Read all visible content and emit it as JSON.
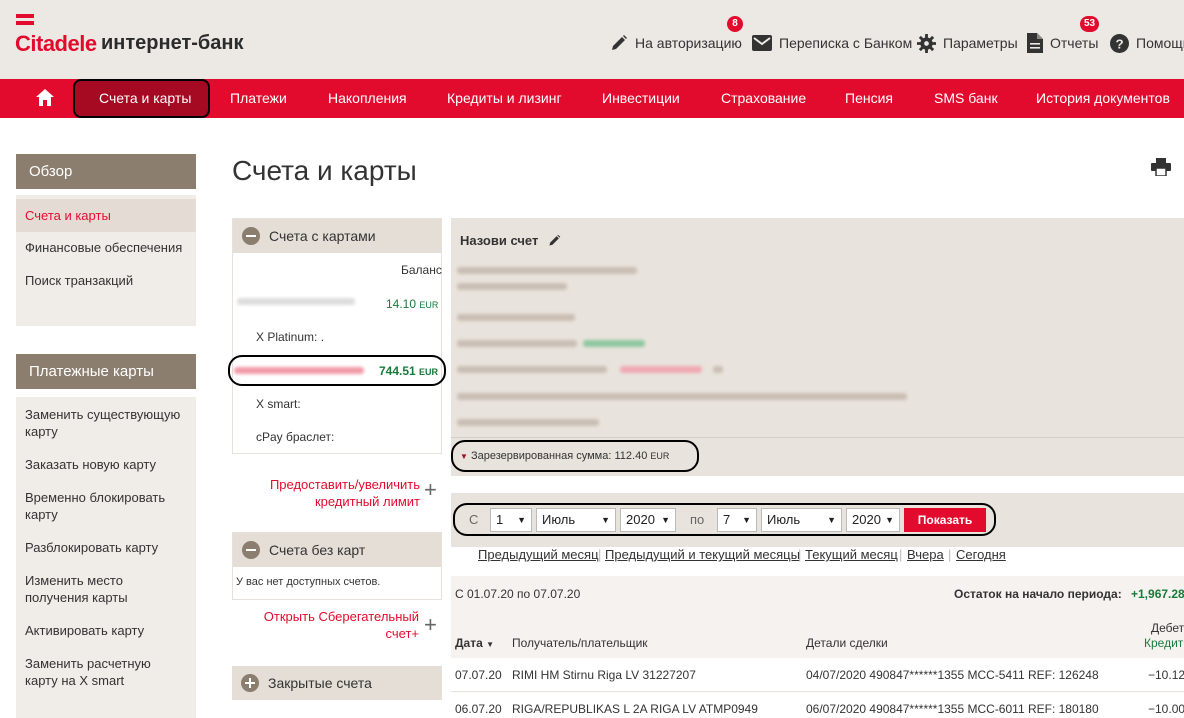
{
  "brand": {
    "name": "Citadele",
    "subtitle": "интернет-банк",
    "accent": "#e30b2d"
  },
  "header": {
    "authorize": {
      "label": "На авторизацию",
      "badge": "8",
      "icon": "pencil-icon"
    },
    "messages": {
      "label": "Переписка с Банком",
      "icon": "envelope-icon"
    },
    "settings": {
      "label": "Параметры",
      "icon": "gear-icon"
    },
    "reports": {
      "label": "Отчеты",
      "badge": "53",
      "icon": "document-icon"
    },
    "help": {
      "label": "Помощь",
      "icon": "help-icon"
    }
  },
  "nav": {
    "home_icon": "home-icon",
    "items": [
      "Счета и карты",
      "Платежи",
      "Накопления",
      "Кредиты и лизинг",
      "Инвестиции",
      "Страхование",
      "Пенсия",
      "SMS банк",
      "История документов"
    ]
  },
  "sidebar": {
    "overview": {
      "title": "Обзор",
      "items": [
        "Счета и карты",
        "Финансовые обеспечения",
        "Поиск транзакций"
      ]
    },
    "cards": {
      "title": "Платежные карты",
      "items": [
        "Заменить существующую карту",
        "Заказать новую карту",
        "Временно блокировать карту",
        "Разблокировать карту",
        "Изменить место получения карты",
        "Активировать карту",
        "Заменить расчетную карту на X smart"
      ]
    }
  },
  "main": {
    "title": "Счета и карты",
    "accounts_with_cards": {
      "title": "Счета с картами",
      "balance_header": "Баланс",
      "accounts": [
        {
          "balance": "14.10",
          "currency": "EUR",
          "card": "X Platinum: ."
        },
        {
          "balance": "744.51",
          "currency": "EUR",
          "cards": [
            "X smart:",
            "cPay браслет:"
          ]
        }
      ]
    },
    "credit_link": "Предоставить/увеличить кредитный лимит",
    "accounts_without_cards": {
      "title": "Счета без карт",
      "empty": "У вас нет доступных счетов."
    },
    "savings_link": "Открыть Сберегательный счет+",
    "closed_accounts": {
      "title": "Закрытые счета"
    },
    "account_detail": {
      "name_label": "Назови счет",
      "reserved_label": "Зарезервированная сумма:",
      "reserved_value": "112.40",
      "reserved_currency": "EUR"
    },
    "filter": {
      "from_label": "С",
      "from_day": "1",
      "from_month": "Июль",
      "from_year": "2020",
      "to_label": "по",
      "to_day": "7",
      "to_month": "Июль",
      "to_year": "2020",
      "show_button": "Показать",
      "quick_links": [
        "Предыдущий месяц",
        "Предыдущий и текущий месяцы",
        "Текущий месяц",
        "Вчера",
        "Сегодня"
      ]
    },
    "statement": {
      "period": "С 01.07.20 по 07.07.20",
      "opening_label": "Остаток на начало периода:",
      "opening_value": "+1,967.28",
      "columns": {
        "date": "Дата",
        "party": "Получатель/плательщик",
        "details": "Детали сделки",
        "debit": "Дебет",
        "credit": "Кредит"
      },
      "rows": [
        {
          "date": "07.07.20",
          "party": "RIMI HM Stirnu Riga LV 31227207",
          "details": "04/07/2020 490847******1355 MCC-5411 REF: 126248",
          "amount": "−10.12"
        },
        {
          "date": "06.07.20",
          "party": "RIGA/REPUBLIKAS L 2A RIGA LV ATMP0949",
          "details": "06/07/2020 490847******1355 MCC-6011 REF: 180180",
          "amount": "−10.00"
        }
      ]
    }
  }
}
